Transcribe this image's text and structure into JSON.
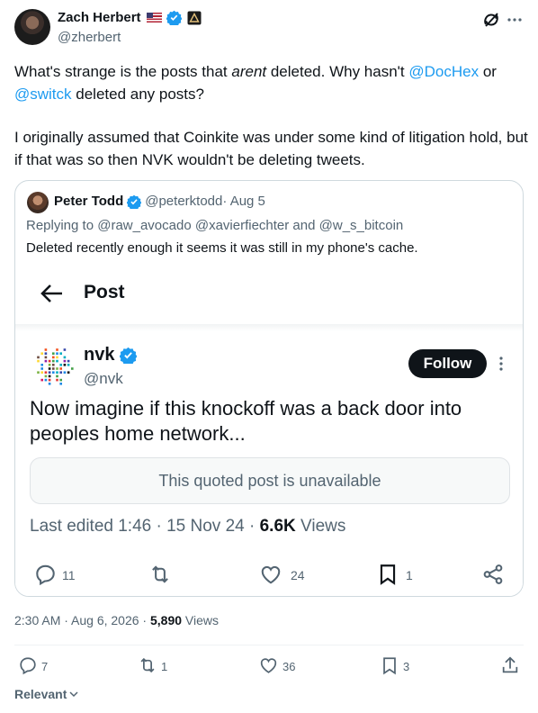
{
  "post": {
    "author_name": "Zach Herbert",
    "author_flag": "🇺🇸",
    "author_handle": "@zherbert",
    "text_1a": "What's strange is the posts that ",
    "text_1b": "arent",
    "text_1c": " deleted. Why hasn't ",
    "mention_1": "@DocHex",
    "text_1d": " or",
    "mention_2": "@switck",
    "text_1e": " deleted any posts?",
    "text_2": "I originally assumed that Coinkite was under some kind of litigation hold, but if that was so then NVK wouldn't be deleting tweets.",
    "timestamp": "2:30 AM · Aug 6, 2026 · ",
    "views_count": "5,890",
    "views_label": " Views",
    "actions": {
      "replies": "7",
      "reposts": "1",
      "likes": "36",
      "bookmarks": "3"
    },
    "relevant_label": "Relevant"
  },
  "quote": {
    "author_name": "Peter Todd",
    "author_handle": "@peterktodd",
    "date": " · Aug 5",
    "replying_prefix": "Replying to ",
    "replying_to": "@raw_avocado @xavierfiechter",
    "replying_and": " and ",
    "replying_last": "@w_s_bitcoin",
    "text": "Deleted recently enough it seems it was still in my phone's cache."
  },
  "screenshot": {
    "header_title": "Post",
    "author_name": "nvk",
    "author_handle": "@nvk",
    "follow_label": "Follow",
    "text": "Now imagine if this knockoff was a back door into peoples home network...",
    "unavailable_text": "This quoted post is unavailable",
    "meta_prefix": "Last edited 1:46 · 15 Nov 24 · ",
    "views_count": "6.6K",
    "views_label": " Views",
    "actions": {
      "replies": "11",
      "likes": "24",
      "bookmarks": "1"
    }
  },
  "colors": {
    "accent": "#1d9bf0",
    "muted": "#536471",
    "border": "#cfd9de",
    "verified": "#1d9bf0"
  },
  "icons": [
    "grok-icon",
    "more-icon",
    "verified-icon",
    "back-arrow-icon",
    "reply-icon",
    "repost-icon",
    "like-icon",
    "bookmark-icon",
    "share-icon",
    "chevron-down-icon"
  ]
}
